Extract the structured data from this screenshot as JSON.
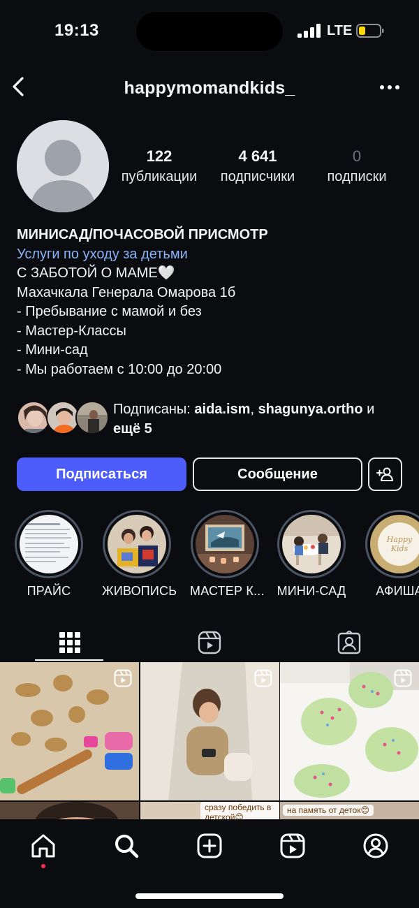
{
  "status_bar": {
    "time": "19:13",
    "network": "LTE"
  },
  "header": {
    "username": "happymomandkids_"
  },
  "stats": [
    {
      "value": "122",
      "label": "публикации"
    },
    {
      "value": "4 641",
      "label": "подписчики"
    },
    {
      "value": "0",
      "label": "подписки"
    }
  ],
  "bio": {
    "name": "МИНИСАД/ПОЧАСОВОЙ ПРИСМОТР",
    "category": "Услуги по уходу за детьми",
    "lines": [
      "С ЗАБОТОЙ О МАМЕ🤍",
      "Махачкала Генерала Омарова 1б",
      "- Пребывание с мамой и без",
      "- Мастер-Классы",
      "- Мини-сад",
      "- Мы работаем с 10:00 до 20:00"
    ]
  },
  "followed_by": {
    "prefix": "Подписаны: ",
    "user1": "aida.ism",
    "separator": ", ",
    "user2": "shagunya.ortho",
    "conjunction": " и",
    "more": "ещё 5"
  },
  "actions": {
    "follow": "Подписаться",
    "message": "Сообщение"
  },
  "highlights": [
    {
      "label": "ПРАЙС"
    },
    {
      "label": "ЖИВОПИСЬ"
    },
    {
      "label": "МАСТЕР К..."
    },
    {
      "label": "МИНИ-САД"
    },
    {
      "label": "АФИША",
      "cover_text": "Happy Kids"
    }
  ],
  "grid_captions": {
    "cell5": "сразу победить в детской😊",
    "cell6": "на память от деток😊"
  },
  "colors": {
    "background": "#0b0c10",
    "accent": "#4c5dfb",
    "link": "#8ab4f8",
    "notification_dot": "#ff2d55"
  },
  "icons": [
    "back-icon",
    "more-icon",
    "add-person-icon",
    "grid-icon",
    "reels-icon",
    "tagged-icon",
    "home-icon",
    "search-icon",
    "create-icon",
    "reels-nav-icon",
    "profile-icon"
  ]
}
